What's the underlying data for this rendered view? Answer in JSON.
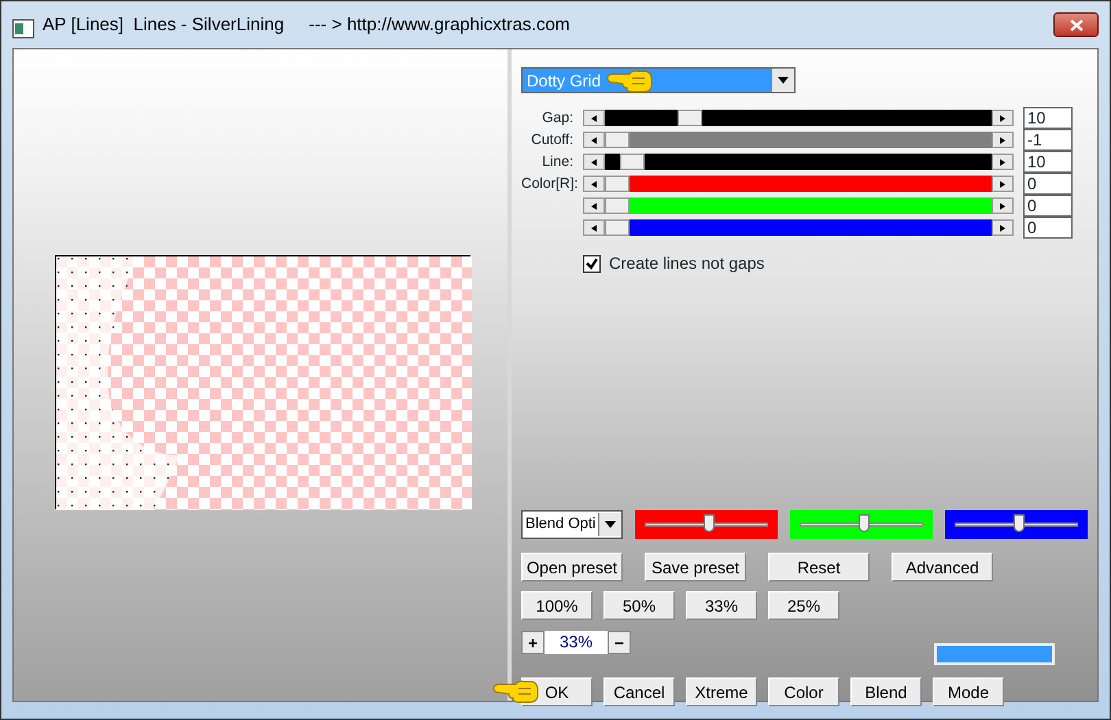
{
  "window": {
    "title": "AP [Lines]  Lines - SilverLining     --- > http://www.graphicxtras.com"
  },
  "effect_dropdown": {
    "value": "Dotty Grid"
  },
  "sliders": [
    {
      "label": "Gap:",
      "color": "#000000",
      "level": 0.2,
      "value": "10"
    },
    {
      "label": "Cutoff:",
      "color": "#808080",
      "level": 0,
      "value": "-1"
    },
    {
      "label": "Line:",
      "color": "#000000",
      "level": 0.04,
      "value": "10"
    },
    {
      "label": "Color[R]:",
      "color": "#ff0000",
      "level": 0,
      "value": "0"
    },
    {
      "color": "#00ff00",
      "level": 0,
      "value": "0"
    },
    {
      "color": "#0000ff",
      "level": 0,
      "value": "0"
    }
  ],
  "create_lines_checkbox": {
    "label": "Create lines not gaps",
    "checked": true
  },
  "blend_dropdown": {
    "value": "Blend Opti"
  },
  "blend_sliders": [
    {
      "color": "#ff0000",
      "level": 0.53
    },
    {
      "color": "#00ff00",
      "level": 0.53
    },
    {
      "color": "#0000ff",
      "level": 0.53
    }
  ],
  "preset_buttons": [
    "Open preset",
    "Save preset",
    "Reset",
    "Advanced"
  ],
  "zoom_buttons": [
    "100%",
    "50%",
    "33%",
    "25%"
  ],
  "zoom_spinner": {
    "plus": "+",
    "value": "33%",
    "minus": "−"
  },
  "color_swatch": {
    "color": "#3399ff"
  },
  "buttons": [
    "OK",
    "Cancel",
    "Xtreme",
    "Color",
    "Blend",
    "Mode"
  ]
}
